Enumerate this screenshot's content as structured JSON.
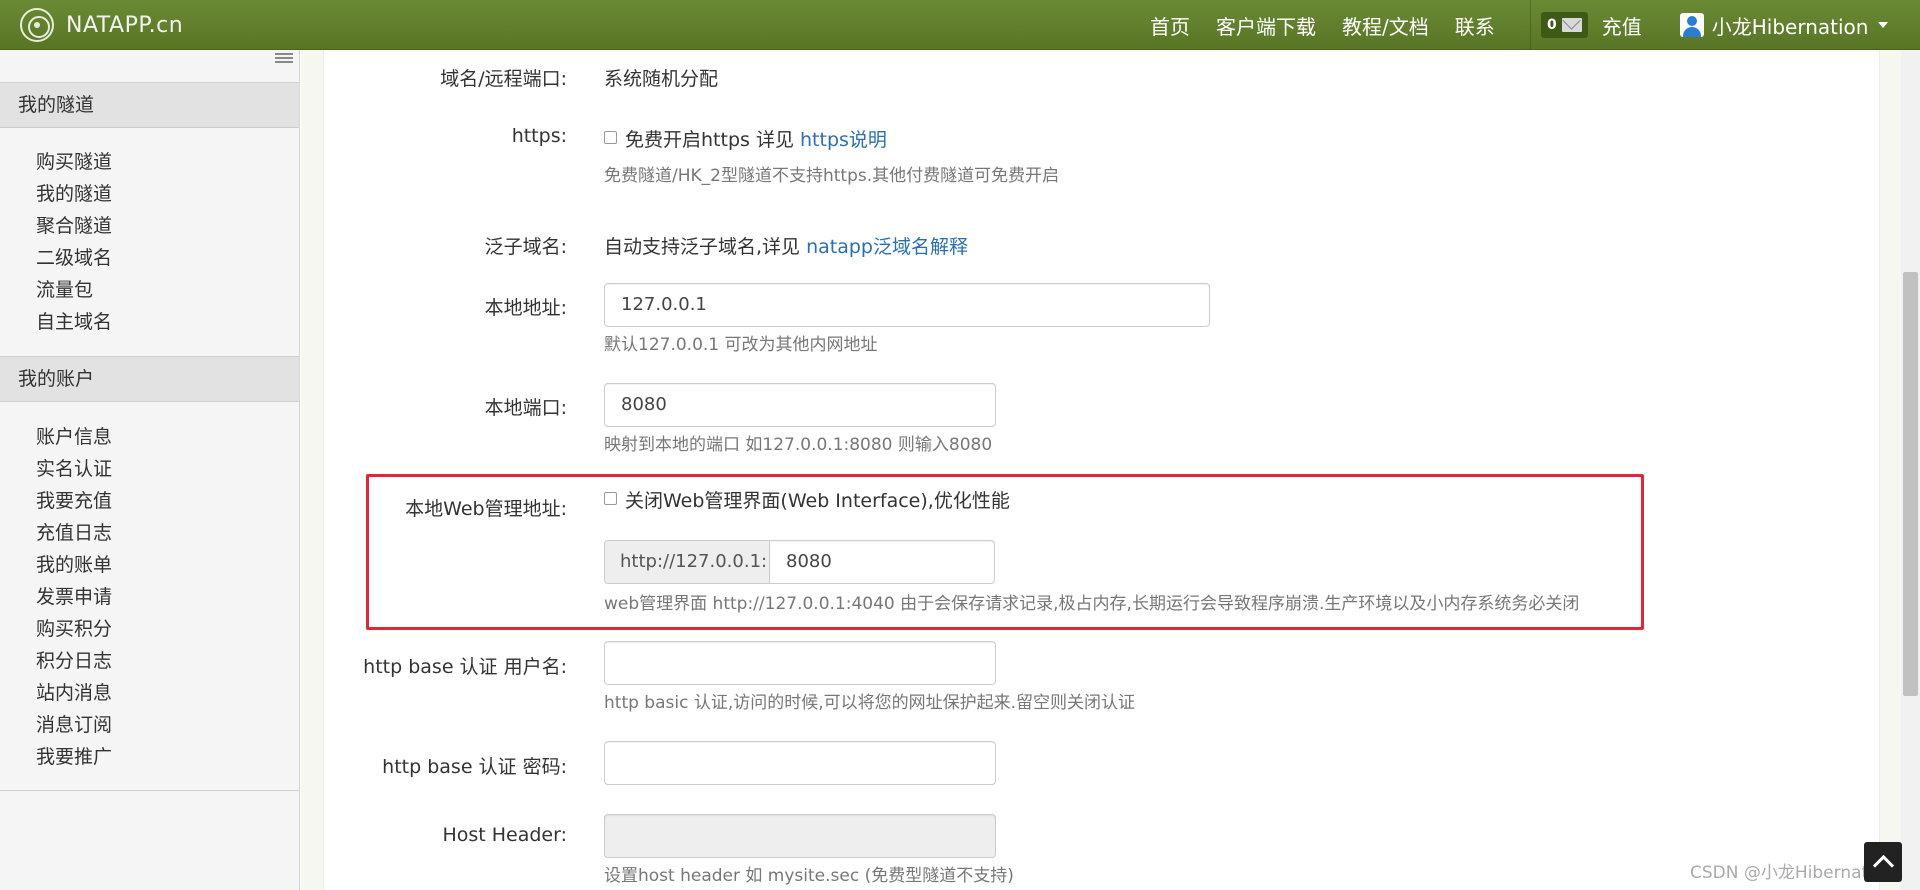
{
  "nav": {
    "brand": "NATAPP.cn",
    "links": [
      "首页",
      "客户端下载",
      "教程/文档",
      "联系"
    ],
    "message_count": "0",
    "recharge": "充值",
    "user": "小龙Hibernation"
  },
  "sidebar": {
    "section1_title": "我的隧道",
    "section1_items": [
      "购买隧道",
      "我的隧道",
      "聚合隧道",
      "二级域名",
      "流量包",
      "自主域名"
    ],
    "section2_title": "我的账户",
    "section2_items": [
      "账户信息",
      "实名认证",
      "我要充值",
      "充值日志",
      "我的账单",
      "发票申请",
      "购买积分",
      "积分日志",
      "站内消息",
      "消息订阅",
      "我要推广"
    ]
  },
  "form": {
    "domain_label": "域名/远程端口:",
    "domain_value": "系统随机分配",
    "https_label": "https:",
    "https_check_text": "免费开启https 详见",
    "https_link": "https说明",
    "https_help": "免费隧道/HK_2型隧道不支持https.其他付费隧道可免费开启",
    "wildcard_label": "泛子域名:",
    "wildcard_text": "自动支持泛子域名,详见",
    "wildcard_link": "natapp泛域名解释",
    "local_addr_label": "本地地址:",
    "local_addr_value": "127.0.0.1",
    "local_addr_help": "默认127.0.0.1 可改为其他内网地址",
    "local_port_label": "本地端口:",
    "local_port_value": "8080",
    "local_port_help": "映射到本地的端口 如127.0.0.1:8080 则输入8080",
    "web_label": "本地Web管理地址:",
    "web_check_text": "关闭Web管理界面(Web Interface),优化性能",
    "web_prefix": "http://127.0.0.1:",
    "web_port_value": "8080",
    "web_help": "web管理界面 http://127.0.0.1:4040 由于会保存请求记录,极占内存,长期运行会导致程序崩溃.生产环境以及小内存系统务必关闭",
    "auth_user_label": "http base 认证 用户名:",
    "auth_user_value": "",
    "auth_help": "http basic 认证,访问的时候,可以将您的网址保护起来.留空则关闭认证",
    "auth_pass_label": "http base 认证 密码:",
    "auth_pass_value": "",
    "host_header_label": "Host Header:",
    "host_header_value": "",
    "host_header_help": "设置host header 如 mysite.sec (免费型隧道不支持)"
  },
  "watermark": "CSDN @小龙Hibernation",
  "colors": {
    "navbar": "#5f7d2b",
    "link": "#2a6fb5",
    "highlight": "#e0263b"
  },
  "icons": [
    "brand-logo-icon",
    "envelope-icon",
    "user-icon",
    "caret-down-icon",
    "menu-collapse-icon",
    "back-to-top-icon"
  ]
}
